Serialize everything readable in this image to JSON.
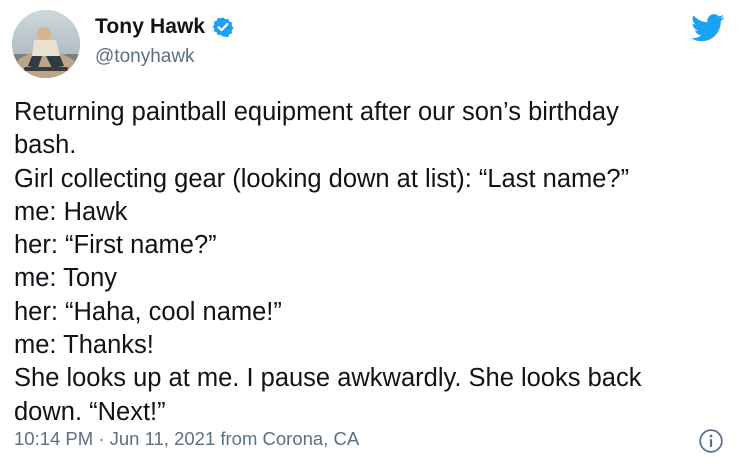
{
  "author": {
    "display_name": "Tony Hawk",
    "handle": "@tonyhawk",
    "verified": true
  },
  "icons": {
    "verified": "verified-badge-icon",
    "brand": "twitter-bird-icon",
    "info": "info-icon"
  },
  "colors": {
    "brand_blue": "#1da1f2",
    "text": "#0f1419",
    "secondary_text": "#5b7083"
  },
  "tweet": {
    "lines": [
      "Returning paintball equipment after our son’s birthday",
      "bash.",
      "Girl collecting gear (looking down at list): “Last name?”",
      "me: Hawk",
      "her: “First name?”",
      "me: Tony",
      "her: “Haha, cool name!”",
      "me: Thanks!",
      "She looks up at me. I pause awkwardly. She looks back",
      "down. “Next!”"
    ]
  },
  "meta": {
    "timestamp": "10:14 PM · Jun 11, 2021 from Corona, CA"
  }
}
